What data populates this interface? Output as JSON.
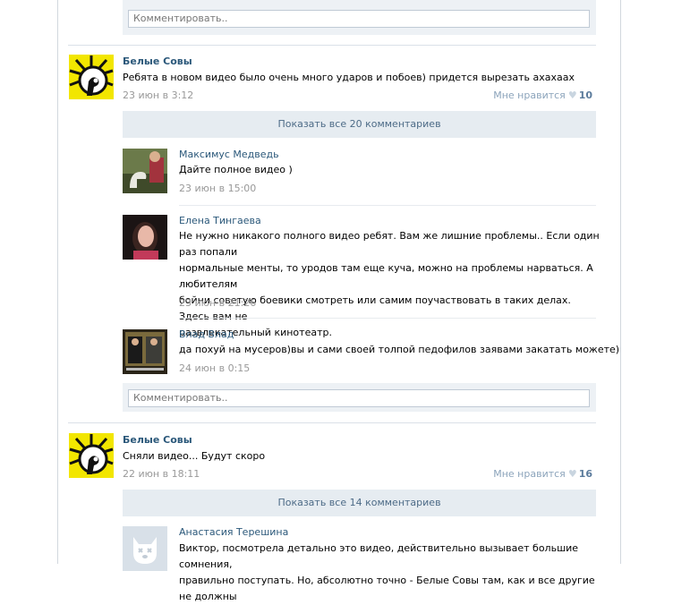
{
  "comment_placeholder": "Комментировать..",
  "posts": [
    {
      "author": "Белые Совы",
      "text": "Ребята в новом видео было очень много ударов и побоев) придется вырезать ахахаах",
      "date": "23 июн в 3:12",
      "like_label": "Мне нравится",
      "like_count": "10",
      "show_all": "Показать все 20 комментариев",
      "comments": [
        {
          "author": "Максимус Медведь",
          "text": "Дайте полное видео )",
          "date": "23 июн в 15:00"
        },
        {
          "author": "Елена Тингаева",
          "lines": [
            "Не нужно никакого полного видео ребят. Вам же лишние проблемы.. Если один раз попали",
            "нормальные менты, то уродов там еще куча, можно на проблемы нарваться. А любителям",
            "бойни советую боевики смотреть или самим поучаствовать в таких делах. Здесь вам не",
            "развлекательный кинотеатр."
          ],
          "date": "23 июн в 21:26"
        },
        {
          "author": "Влад Влад",
          "text": "да похуй на мусеров)вы и сами своей толпой педофилов заявами закатать можете)",
          "date": "24 июн в 0:15"
        }
      ]
    },
    {
      "author": "Белые Совы",
      "text": "Сняли видео... Будут скоро",
      "date": "22 июн в 18:11",
      "like_label": "Мне нравится",
      "like_count": "16",
      "show_all": "Показать все 14 комментариев",
      "comments": [
        {
          "author": "Анастасия Терешина",
          "lines": [
            "Виктор, посмотрела детально это видео, действительно вызывает большие сомнения,",
            "правильно поступать. Но, абсолютно точно - Белые Совы там, как и все другие не должны"
          ]
        }
      ]
    }
  ],
  "colors": {
    "link": "#2b587a",
    "muted": "#999999",
    "panel": "#edf1f5",
    "show_all_bg": "#e6ecf1",
    "brand_yellow": "#f2e600"
  },
  "icons": {
    "like": "heart-icon",
    "deleted_avatar": "dog-avatar-icon"
  }
}
